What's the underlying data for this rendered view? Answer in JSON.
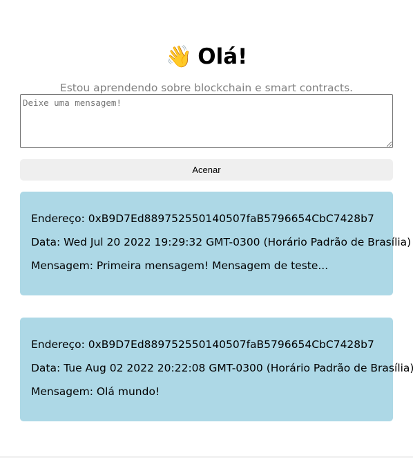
{
  "header": {
    "emoji": "👋",
    "title": "Olá!"
  },
  "bio": "Estou aprendendo sobre blockchain e smart contracts.",
  "message_input": {
    "value": "",
    "placeholder": "Deixe uma mensagem!"
  },
  "wave_button": {
    "label": "Acenar"
  },
  "waves": [
    {
      "address": "Endereço: 0xB9D7Ed889752550140507faB5796654CbC7428b7",
      "date": "Data: Wed Jul 20 2022 19:29:32 GMT-0300 (Horário Padrão de Brasília)",
      "message": "Mensagem: Primeira mensagem! Mensagem de teste..."
    },
    {
      "address": "Endereço: 0xB9D7Ed889752550140507faB5796654CbC7428b7",
      "date": "Data: Tue Aug 02 2022 20:22:08 GMT-0300 (Horário Padrão de Brasília)",
      "message": "Mensagem: Olá mundo!"
    }
  ],
  "colors": {
    "card_background": "#add8e6",
    "button_background": "#efefef",
    "bio_text": "#808080"
  }
}
